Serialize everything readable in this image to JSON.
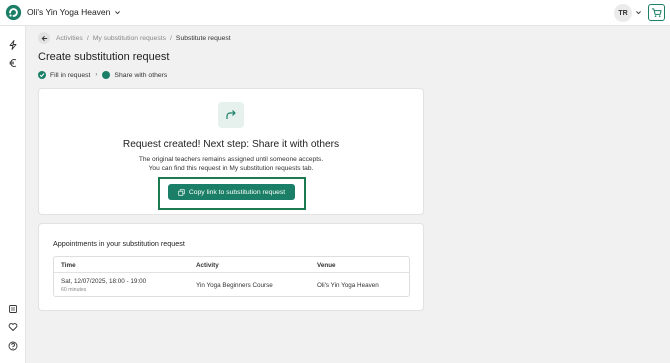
{
  "header": {
    "studio_name": "Oli's Yin Yoga Heaven",
    "user_initials": "TR",
    "accent_color": "#1a7f66"
  },
  "sidebar": {
    "icons": [
      "lightning-icon",
      "euro-icon",
      "book-icon",
      "heart-icon",
      "help-icon"
    ]
  },
  "breadcrumb": {
    "items": [
      "Activities",
      "My substitution requests",
      "Substitute request"
    ],
    "separator": "/"
  },
  "page_title": "Create substitution request",
  "stepper": {
    "step1": "Fill in request",
    "step2": "Share with others",
    "separator": "›"
  },
  "success": {
    "headline": "Request created! Next step: Share it with others",
    "line1": "The original teachers remains assigned until someone accepts.",
    "line2": "You can find this request in My substitution requests tab.",
    "copy_button": "Copy link to substitution request"
  },
  "appointments": {
    "title": "Appointments in your substitution request",
    "columns": [
      "Time",
      "Activity",
      "Venue"
    ],
    "rows": [
      {
        "time": "Sat, 12/07/2025, 18:00 - 19:00",
        "duration": "60 minutes",
        "activity": "Yin Yoga Beginners Course",
        "venue": "Oli's Yin Yoga Heaven"
      }
    ]
  }
}
